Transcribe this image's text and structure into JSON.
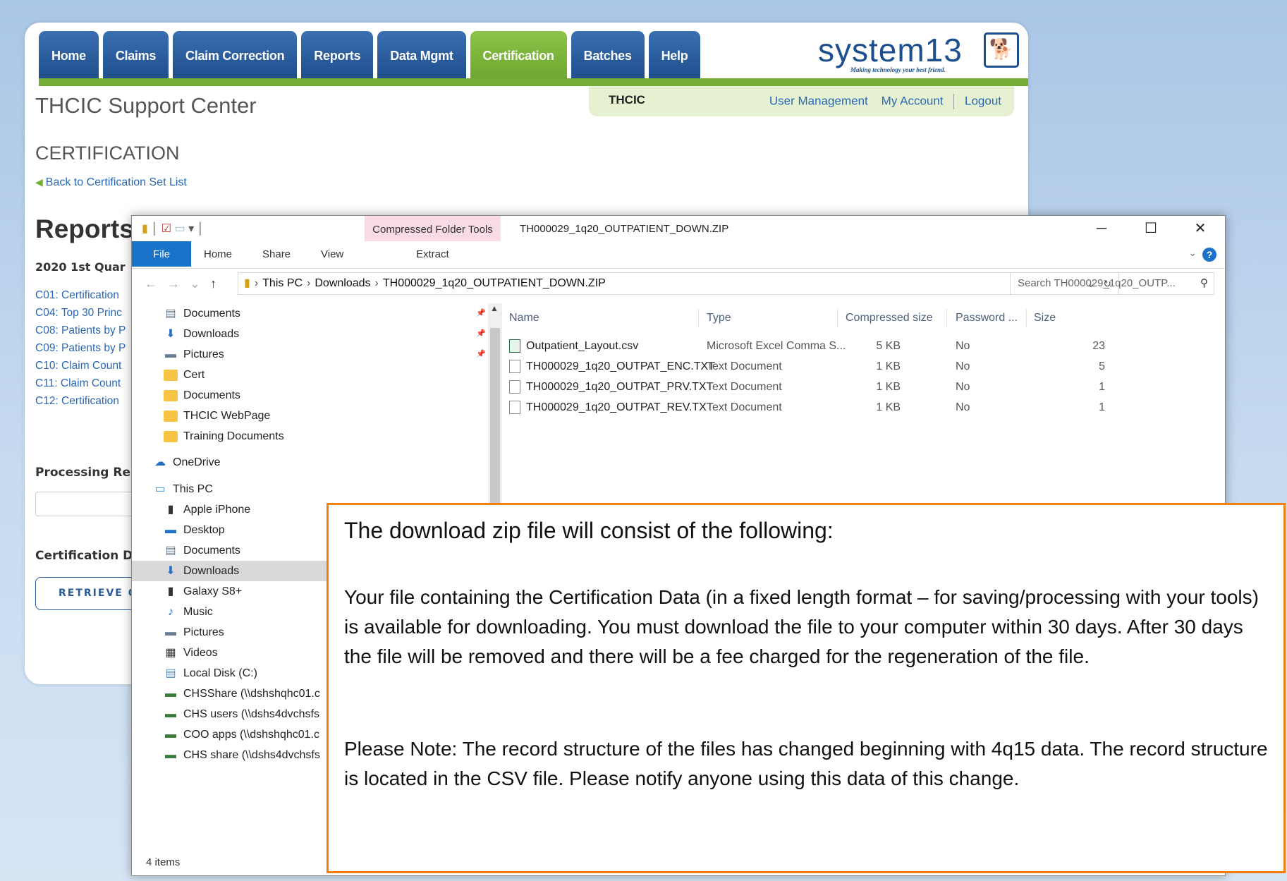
{
  "portal": {
    "nav_tabs": [
      {
        "label": "Home"
      },
      {
        "label": "Claims"
      },
      {
        "label": "Claim Correction"
      },
      {
        "label": "Reports"
      },
      {
        "label": "Data Mgmt"
      },
      {
        "label": "Certification"
      },
      {
        "label": "Batches"
      },
      {
        "label": "Help"
      }
    ],
    "active_tab": "Certification",
    "logo_text": "system13",
    "logo_tagline": "Making technology your best friend.",
    "org": "THCIC",
    "links": {
      "user_management": "User Management",
      "my_account": "My Account",
      "logout": "Logout"
    },
    "site_title": "THCIC Support Center",
    "section_title": "CERTIFICATION",
    "back_link": "Back to Certification Set List",
    "reports_heading": "Reports",
    "quarter": "2020 1st Quar",
    "report_links": [
      "C01: Certification",
      "C04: Top 30 Princ",
      "C08: Patients by P",
      "C09: Patients by P",
      "C10: Claim Count",
      "C11: Claim Count",
      "C12: Certification"
    ],
    "processing_label": "Processing Re",
    "certification_label": "Certification D",
    "retrieve_button": "RETRIEVE CE"
  },
  "explorer": {
    "context_tab": "Compressed Folder Tools",
    "window_title": "TH000029_1q20_OUTPATIENT_DOWN.ZIP",
    "ribbon_tabs": {
      "file": "File",
      "home": "Home",
      "share": "Share",
      "view": "View",
      "extract": "Extract"
    },
    "address": {
      "this_pc": "This PC",
      "downloads": "Downloads",
      "zip": "TH000029_1q20_OUTPATIENT_DOWN.ZIP"
    },
    "search_placeholder": "Search TH000029_1q20_OUTP...",
    "nav_items": [
      {
        "label": "Documents",
        "icon": "documents-icon",
        "pinned": true
      },
      {
        "label": "Downloads",
        "icon": "downloads-icon",
        "pinned": true
      },
      {
        "label": "Pictures",
        "icon": "pictures-icon",
        "pinned": true
      },
      {
        "label": "Cert",
        "icon": "folder-icon"
      },
      {
        "label": "Documents",
        "icon": "folder-icon"
      },
      {
        "label": "THCIC WebPage",
        "icon": "folder-icon"
      },
      {
        "label": "Training Documents",
        "icon": "folder-icon"
      },
      {
        "label": "OneDrive",
        "icon": "onedrive-icon"
      },
      {
        "label": "This PC",
        "icon": "this-pc-icon"
      },
      {
        "label": "Apple iPhone",
        "icon": "phone-icon"
      },
      {
        "label": "Desktop",
        "icon": "desktop-icon"
      },
      {
        "label": "Documents",
        "icon": "documents-icon"
      },
      {
        "label": "Downloads",
        "icon": "downloads-icon",
        "selected": true
      },
      {
        "label": "Galaxy S8+",
        "icon": "phone-icon"
      },
      {
        "label": "Music",
        "icon": "music-icon"
      },
      {
        "label": "Pictures",
        "icon": "pictures-icon"
      },
      {
        "label": "Videos",
        "icon": "videos-icon"
      },
      {
        "label": "Local Disk (C:)",
        "icon": "disk-icon"
      },
      {
        "label": "CHSShare (\\\\dshshqhc01.c",
        "icon": "network-drive-icon"
      },
      {
        "label": "CHS users (\\\\dshs4dvchsfs",
        "icon": "network-drive-icon"
      },
      {
        "label": "COO apps (\\\\dshshqhc01.c",
        "icon": "network-drive-icon"
      },
      {
        "label": "CHS share (\\\\dshs4dvchsfs",
        "icon": "network-drive-icon"
      }
    ],
    "columns": [
      "Name",
      "Type",
      "Compressed size",
      "Password ...",
      "Size"
    ],
    "files": [
      {
        "name": "Outpatient_Layout.csv",
        "type": "Microsoft Excel Comma S...",
        "compressed": "5 KB",
        "password": "No",
        "size": "23",
        "icon": "excel-csv-icon"
      },
      {
        "name": "TH000029_1q20_OUTPAT_ENC.TXT",
        "type": "Text Document",
        "compressed": "1 KB",
        "password": "No",
        "size": "5",
        "icon": "text-file-icon"
      },
      {
        "name": "TH000029_1q20_OUTPAT_PRV.TXT",
        "type": "Text Document",
        "compressed": "1 KB",
        "password": "No",
        "size": "1",
        "icon": "text-file-icon"
      },
      {
        "name": "TH000029_1q20_OUTPAT_REV.TXT",
        "type": "Text Document",
        "compressed": "1 KB",
        "password": "No",
        "size": "1",
        "icon": "text-file-icon"
      }
    ],
    "status": "4 items"
  },
  "callout": {
    "heading": "The download zip file will consist of the following:",
    "paragraph1": "Your file containing the Certification Data (in a fixed length format – for saving/processing with your tools) is available for downloading. You must download the file to your computer within 30 days. After 30 days the file will be removed and there will be a fee charged for the regeneration of the file.",
    "paragraph2": "Please Note: The record structure of the files has changed beginning with 4q15 data. The record structure is located in the CSV file. Please notify anyone using this data of this change."
  },
  "colors": {
    "nav_blue": "#2a5f9e",
    "nav_green": "#7ab53c",
    "callout_border": "#f07f10",
    "link_blue": "#2a67b5"
  }
}
